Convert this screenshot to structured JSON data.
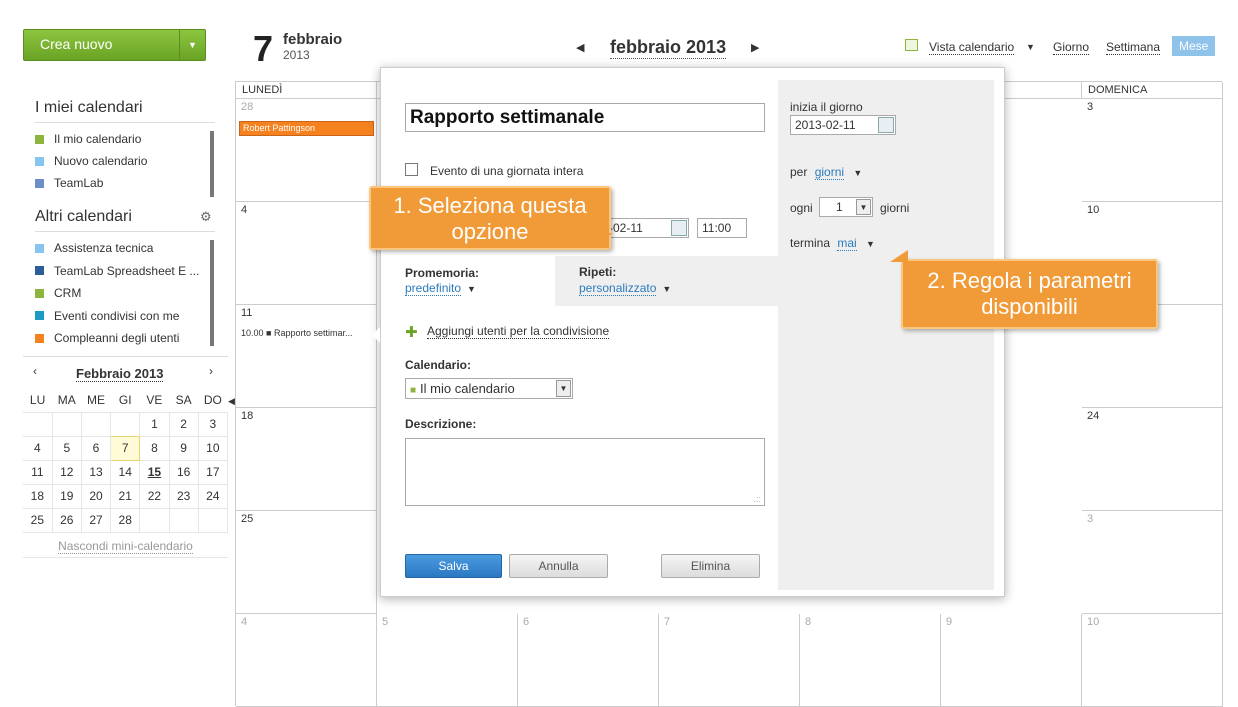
{
  "sidebar": {
    "create_label": "Crea nuovo",
    "my_calendars_title": "I miei calendari",
    "my_calendars": [
      {
        "label": "Il mio calendario",
        "color": "#8db53d"
      },
      {
        "label": "Nuovo calendario",
        "color": "#86c6ee"
      },
      {
        "label": "TeamLab",
        "color": "#6d8fc7"
      }
    ],
    "other_calendars_title": "Altri calendari",
    "other_calendars": [
      {
        "label": "Assistenza tecnica",
        "color": "#86c6ee"
      },
      {
        "label": "TeamLab Spreadsheet E ...",
        "color": "#2c5d96"
      },
      {
        "label": "CRM",
        "color": "#8db53d"
      },
      {
        "label": "Eventi condivisi con me",
        "color": "#1b9bc4"
      },
      {
        "label": "Compleanni degli utenti",
        "color": "#f5821f"
      }
    ],
    "mini": {
      "month": "Febbraio",
      "year": "2013",
      "weekdays": [
        "LU",
        "MA",
        "ME",
        "GI",
        "VE",
        "SA",
        "DO"
      ],
      "weeks": [
        [
          "",
          "",
          "",
          "",
          "1",
          "2",
          "3"
        ],
        [
          "4",
          "5",
          "6",
          "7",
          "8",
          "9",
          "10"
        ],
        [
          "11",
          "12",
          "13",
          "14",
          "15",
          "16",
          "17"
        ],
        [
          "18",
          "19",
          "20",
          "21",
          "22",
          "23",
          "24"
        ],
        [
          "25",
          "26",
          "27",
          "28",
          "",
          "",
          ""
        ]
      ],
      "hide_label": "Nascondi mini-calendario"
    }
  },
  "header": {
    "day": "7",
    "month": "febbraio",
    "year": "2013",
    "nav_month": "febbraio",
    "nav_year": "2013",
    "view_label": "Vista calendario",
    "day_view": "Giorno",
    "week_view": "Settimana",
    "month_view": "Mese"
  },
  "grid": {
    "monday": "LUNEDÌ",
    "sunday": "DOMENICA",
    "event_birthday": "Robert Pattingson",
    "event_report": "10.00 ■ Rapporto settimar...",
    "nums": {
      "r0c0": "28",
      "r0c6": "3",
      "r1c0": "4",
      "r1c6": "10",
      "r2c0": "11",
      "r3c0": "18",
      "r3c6": "24",
      "r4c0": "25",
      "r4c6": "3",
      "r5c0": "4",
      "r5c1": "5",
      "r5c2": "6",
      "r5c3": "7",
      "r5c4": "8",
      "r5c5": "9",
      "r5c6": "10"
    }
  },
  "popup": {
    "title_value": "Rapporto settimanale",
    "all_day_label": "Evento di una giornata intera",
    "date_value": "-02-11",
    "time_value": "11:00",
    "reminder_label": "Promemoria:",
    "reminder_value": "predefinito",
    "repeat_label": "Ripeti:",
    "repeat_value": "personalizzato",
    "share_label": "Aggiungi utenti per la condivisione",
    "calendar_label": "Calendario:",
    "calendar_value": "Il mio calendario",
    "description_label": "Descrizione:",
    "save_label": "Salva",
    "cancel_label": "Annulla",
    "delete_label": "Elimina",
    "start_label": "inizia il giorno",
    "start_value": "2013-02-11",
    "per_label": "per",
    "per_value": "giorni",
    "every_label": "ogni",
    "every_value": "1",
    "every_unit": "giorni",
    "ends_label": "termina",
    "ends_value": "mai"
  },
  "callouts": {
    "one": "1. Seleziona questa opzione",
    "two": "2. Regola i parametri disponibili"
  }
}
